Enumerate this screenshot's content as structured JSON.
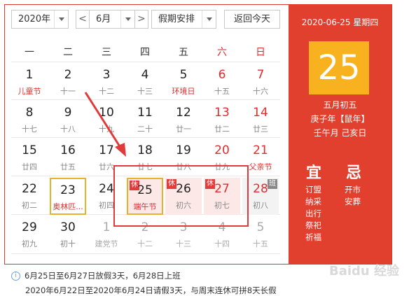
{
  "toolbar": {
    "year": "2020年",
    "prev": "<",
    "month": "6月",
    "next": ">",
    "holiday_select": "假期安排",
    "today_button": "返回今天"
  },
  "weekdays": [
    "一",
    "二",
    "三",
    "四",
    "五",
    "六",
    "日"
  ],
  "rows": [
    [
      {
        "d": "1",
        "l": "儿童节",
        "fest": true
      },
      {
        "d": "2",
        "l": "十一"
      },
      {
        "d": "3",
        "l": "十二"
      },
      {
        "d": "4",
        "l": "十三"
      },
      {
        "d": "5",
        "l": "环境日",
        "fest": true
      },
      {
        "d": "6",
        "l": "十五",
        "we": true
      },
      {
        "d": "7",
        "l": "十六",
        "we": true
      }
    ],
    [
      {
        "d": "8",
        "l": "十七"
      },
      {
        "d": "9",
        "l": "十八"
      },
      {
        "d": "10",
        "l": "十九"
      },
      {
        "d": "11",
        "l": "二十"
      },
      {
        "d": "12",
        "l": "廿一"
      },
      {
        "d": "13",
        "l": "廿二",
        "we": true
      },
      {
        "d": "14",
        "l": "廿三",
        "we": true
      }
    ],
    [
      {
        "d": "15",
        "l": "廿四"
      },
      {
        "d": "16",
        "l": "廿五"
      },
      {
        "d": "17",
        "l": "廿六"
      },
      {
        "d": "18",
        "l": "廿七"
      },
      {
        "d": "19",
        "l": "廿八"
      },
      {
        "d": "20",
        "l": "廿九",
        "we": true
      },
      {
        "d": "21",
        "l": "父亲节",
        "we": true,
        "fest": true
      }
    ],
    [
      {
        "d": "22",
        "l": "初二"
      },
      {
        "d": "23",
        "l": "奥林匹...",
        "fest": true,
        "selected": true
      },
      {
        "d": "24",
        "l": "初四"
      },
      {
        "d": "25",
        "l": "端午节",
        "fest": true,
        "hol": true,
        "tag": "休",
        "today": true
      },
      {
        "d": "26",
        "l": "初六",
        "hol": true,
        "tag": "休"
      },
      {
        "d": "27",
        "l": "初七",
        "hol": true,
        "tag": "休",
        "we": true
      },
      {
        "d": "28",
        "l": "初八",
        "work": true,
        "tag": "班",
        "we": true
      }
    ],
    [
      {
        "d": "29",
        "l": "初九"
      },
      {
        "d": "30",
        "l": "初十"
      },
      {
        "d": "1",
        "l": "建党节",
        "dim": true
      },
      {
        "d": "2",
        "l": "十二",
        "dim": true
      },
      {
        "d": "3",
        "l": "十三",
        "dim": true
      },
      {
        "d": "4",
        "l": "十四",
        "dim": true
      },
      {
        "d": "5",
        "l": "十五",
        "dim": true
      }
    ]
  ],
  "panel": {
    "date": "2020-06-25 星期四",
    "day": "25",
    "lunar1": "五月初五",
    "lunar2": "庚子年【鼠年】",
    "lunar3": "壬午月 己亥日",
    "yi": "宜",
    "ji": "忌",
    "yi_items": [
      "订盟",
      "纳采",
      "出行",
      "祭祀",
      "祈福"
    ],
    "ji_items": [
      "开市",
      "安葬"
    ]
  },
  "notice": {
    "line1": "6月25日至6月27日放假3天，6月28日上班",
    "line2": "2020年6月22日至2020年6月24日请假3天，与周末连休可拼8天长假"
  },
  "watermark": "Baidu 经验"
}
